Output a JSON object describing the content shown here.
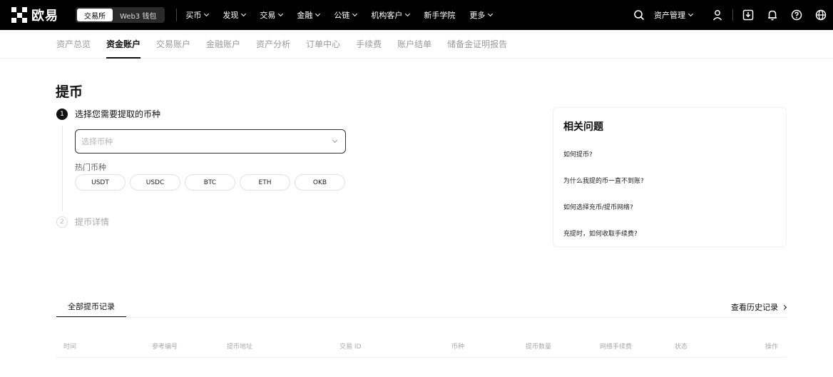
{
  "topbar": {
    "logo_text": "欧易",
    "switch": [
      "交易所",
      "Web3 钱包"
    ],
    "nav": [
      {
        "label": "买币",
        "dropdown": true
      },
      {
        "label": "发现",
        "dropdown": true
      },
      {
        "label": "交易",
        "dropdown": true
      },
      {
        "label": "金融",
        "dropdown": true
      },
      {
        "label": "公链",
        "dropdown": true
      },
      {
        "label": "机构客户",
        "dropdown": true
      },
      {
        "label": "新手学院",
        "dropdown": false
      },
      {
        "label": "更多",
        "dropdown": true
      }
    ],
    "assets_label": "资产管理",
    "icons": [
      "search-icon",
      "user-icon",
      "download-icon",
      "bell-icon",
      "help-icon",
      "globe-icon"
    ]
  },
  "subnav": [
    "资产总览",
    "资金账户",
    "交易账户",
    "金融账户",
    "资产分析",
    "订单中心",
    "手续费",
    "账户结单",
    "储备金证明报告"
  ],
  "main": {
    "title": "提币",
    "step1": {
      "num": "1",
      "label": "选择您需要提取的币种"
    },
    "select_placeholder": "选择币种",
    "hot_label": "热门币种",
    "chips": [
      "USDT",
      "USDC",
      "BTC",
      "ETH",
      "OKB"
    ],
    "step2": {
      "num": "2",
      "label": "提币详情"
    }
  },
  "faq": {
    "title": "相关问题",
    "questions": [
      "如何提币?",
      "为什么我提的币一直不到账?",
      "如何选择充币/提币网络?",
      "充提时，如何收取手续费?"
    ]
  },
  "history": {
    "tab": "全部提币记录",
    "view_all": "查看历史记录",
    "columns": [
      "时间",
      "参考编号",
      "提币地址",
      "交易 ID",
      "币种",
      "提币数量",
      "网络手续费",
      "状态",
      "操作"
    ]
  },
  "colors": {
    "topbar": "#000000",
    "active": "#111111",
    "muted": "#9a9a9a"
  }
}
